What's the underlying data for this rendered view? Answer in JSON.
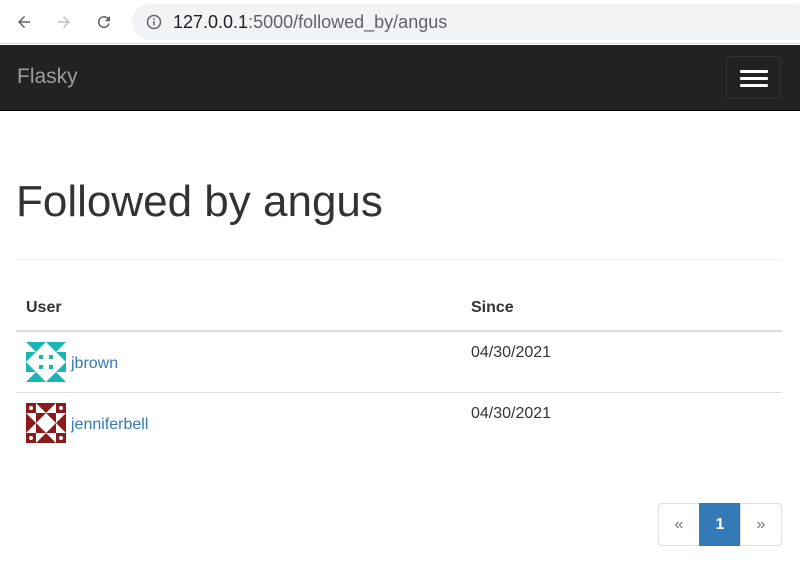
{
  "browser": {
    "url_host": "127.0.0.1",
    "url_rest": ":5000/followed_by/angus"
  },
  "navbar": {
    "brand": "Flasky",
    "menu_icon": "hamburger-icon"
  },
  "page": {
    "title": "Followed by angus"
  },
  "table": {
    "headers": [
      "User",
      "Since"
    ],
    "rows": [
      {
        "username": "jbrown",
        "since": "04/30/2021",
        "avatar_color": "#1bb5b5"
      },
      {
        "username": "jenniferbell",
        "since": "04/30/2021",
        "avatar_color": "#8b1a1a"
      }
    ]
  },
  "pagination": {
    "prev": "«",
    "current": "1",
    "next": "»",
    "active_color": "#337ab7"
  }
}
